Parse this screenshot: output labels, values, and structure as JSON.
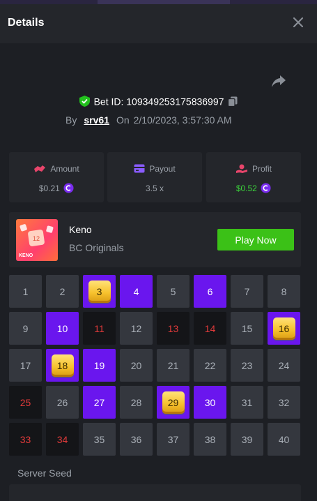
{
  "header": {
    "title": "Details"
  },
  "bet": {
    "id_label": "Bet ID:",
    "id": "109349253175836997",
    "by_label": "By",
    "user": "srv61",
    "on_label": "On",
    "date": "2/10/2023, 3:57:30 AM"
  },
  "stats": [
    {
      "label": "Amount",
      "value": "$0.21",
      "icon": "amount-icon",
      "color": "#e8456b"
    },
    {
      "label": "Payout",
      "value": "3.5 x",
      "icon": "payout-icon",
      "color": "#8a5cff"
    },
    {
      "label": "Profit",
      "value": "$0.52",
      "icon": "profit-icon",
      "color": "#e8456b"
    }
  ],
  "game": {
    "name": "Keno",
    "subtitle": "BC Originals",
    "thumb_text": "KENO",
    "thumb_number": "12",
    "play_label": "Play Now"
  },
  "board": {
    "cells": [
      {
        "n": "1",
        "s": "normal"
      },
      {
        "n": "2",
        "s": "normal"
      },
      {
        "n": "3",
        "s": "gem"
      },
      {
        "n": "4",
        "s": "hit"
      },
      {
        "n": "5",
        "s": "normal"
      },
      {
        "n": "6",
        "s": "hit"
      },
      {
        "n": "7",
        "s": "normal"
      },
      {
        "n": "8",
        "s": "normal"
      },
      {
        "n": "9",
        "s": "normal"
      },
      {
        "n": "10",
        "s": "hit"
      },
      {
        "n": "11",
        "s": "miss"
      },
      {
        "n": "12",
        "s": "normal"
      },
      {
        "n": "13",
        "s": "miss"
      },
      {
        "n": "14",
        "s": "miss"
      },
      {
        "n": "15",
        "s": "normal"
      },
      {
        "n": "16",
        "s": "gem"
      },
      {
        "n": "17",
        "s": "normal"
      },
      {
        "n": "18",
        "s": "gem"
      },
      {
        "n": "19",
        "s": "hit"
      },
      {
        "n": "20",
        "s": "normal"
      },
      {
        "n": "21",
        "s": "normal"
      },
      {
        "n": "22",
        "s": "normal"
      },
      {
        "n": "23",
        "s": "normal"
      },
      {
        "n": "24",
        "s": "normal"
      },
      {
        "n": "25",
        "s": "miss"
      },
      {
        "n": "26",
        "s": "normal"
      },
      {
        "n": "27",
        "s": "hit"
      },
      {
        "n": "28",
        "s": "normal"
      },
      {
        "n": "29",
        "s": "gem"
      },
      {
        "n": "30",
        "s": "hit"
      },
      {
        "n": "31",
        "s": "normal"
      },
      {
        "n": "32",
        "s": "normal"
      },
      {
        "n": "33",
        "s": "miss"
      },
      {
        "n": "34",
        "s": "miss"
      },
      {
        "n": "35",
        "s": "normal"
      },
      {
        "n": "36",
        "s": "normal"
      },
      {
        "n": "37",
        "s": "normal"
      },
      {
        "n": "38",
        "s": "normal"
      },
      {
        "n": "39",
        "s": "normal"
      },
      {
        "n": "40",
        "s": "normal"
      }
    ]
  },
  "seed": {
    "label": "Server Seed"
  },
  "colors": {
    "hit": "#6a16ee",
    "miss_text": "#e03a3a",
    "play": "#3bc117",
    "profit": "#3bd13b"
  }
}
